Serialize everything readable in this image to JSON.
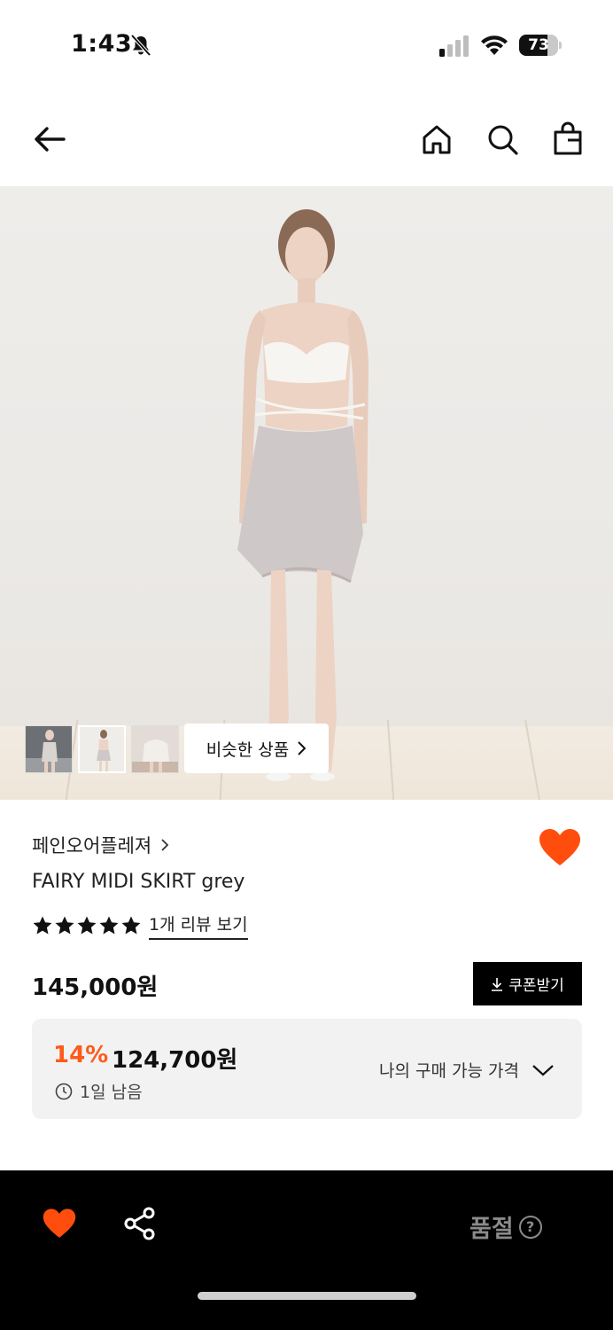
{
  "status_bar": {
    "time": "1:43",
    "battery": "73",
    "battery_level": 0.73
  },
  "nav": {
    "back_icon": "arrow-left-icon",
    "home_icon": "home-icon",
    "search_icon": "search-icon",
    "cart_icon": "shopping-bag-icon"
  },
  "gallery": {
    "similar_label": "비슷한 상품",
    "thumbnail_count": 3
  },
  "product": {
    "brand": "페인오어플레져",
    "name": "FAIRY MIDI SKIRT grey",
    "rating": 5,
    "review_link": "1개 리뷰 보기",
    "price": "145,000원",
    "coupon_label": "쿠폰받기",
    "discount_percent": "14%",
    "discount_price": "124,700원",
    "time_left": "1일 남음",
    "my_price_label": "나의 구매 가능 가격"
  },
  "bottom_bar": {
    "status_label": "품절",
    "help_glyph": "?"
  },
  "colors": {
    "accent": "#ff4d0d",
    "discount": "#ff5a1a",
    "bottom_bar_bg": "#000000",
    "soldout_text": "#8a8a8a"
  }
}
